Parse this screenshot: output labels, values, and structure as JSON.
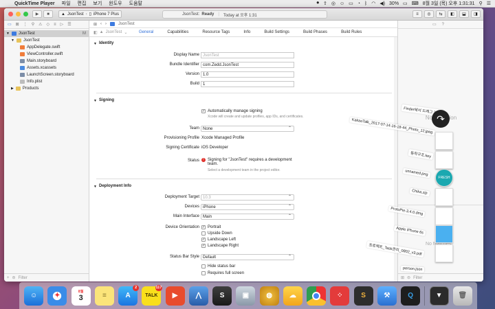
{
  "menubar": {
    "app": "QuickTime Player",
    "items": [
      "파일",
      "편집",
      "보기",
      "윈도우",
      "도움말"
    ],
    "battery": "30%",
    "date": "8월 3일 (목) 오후 1:31:31"
  },
  "toolbar": {
    "scheme": "JsonTest",
    "device": "iPhone 7 Plus",
    "status_prefix": "JsonTest:",
    "status": "Ready",
    "timestamp": "Today at 오후 1:31"
  },
  "navigator": {
    "filter_placeholder": "Filter",
    "items": [
      {
        "label": "JsonTest",
        "badge": "M"
      },
      {
        "label": "JsonTest"
      },
      {
        "label": "AppDelegate.swift"
      },
      {
        "label": "ViewController.swift"
      },
      {
        "label": "Main.storyboard"
      },
      {
        "label": "Assets.xcassets"
      },
      {
        "label": "LaunchScreen.storyboard"
      },
      {
        "label": "Info.plist"
      },
      {
        "label": "Products"
      }
    ]
  },
  "editor": {
    "breadcrumb": "JsonTest",
    "target": "JsonTest",
    "tabs": [
      "General",
      "Capabilities",
      "Resource Tags",
      "Info",
      "Build Settings",
      "Build Phases",
      "Build Rules"
    ],
    "identity": {
      "title": "Identity",
      "display_name_label": "Display Name",
      "display_name_placeholder": "JsonTest",
      "bundle_label": "Bundle Identifier",
      "bundle_value": "com.Zedd.JsonTest",
      "version_label": "Version",
      "version_value": "1.0",
      "build_label": "Build",
      "build_value": "1"
    },
    "signing": {
      "title": "Signing",
      "auto_label": "Automatically manage signing",
      "auto_note": "Xcode will create and update profiles, app IDs, and certificates.",
      "team_label": "Team",
      "team_value": "None",
      "profile_label": "Provisioning Profile",
      "profile_value": "Xcode Managed Profile",
      "cert_label": "Signing Certificate",
      "cert_value": "iOS Developer",
      "status_label": "Status",
      "status_value": "Signing for \"JsonTest\" requires a development team.",
      "status_note": "Select a development team in the project editor."
    },
    "deployment": {
      "title": "Deployment Info",
      "target_label": "Deployment Target",
      "target_value": "10.3",
      "devices_label": "Devices",
      "devices_value": "iPhone",
      "interface_label": "Main Interface",
      "interface_value": "Main",
      "orientation_label": "Device Orientation",
      "orientations": [
        {
          "label": "Portrait",
          "checked": true
        },
        {
          "label": "Upside Down",
          "checked": false
        },
        {
          "label": "Landscape Left",
          "checked": true
        },
        {
          "label": "Landscape Right",
          "checked": true
        }
      ],
      "statusbar_label": "Status Bar Style",
      "statusbar_value": "Default",
      "hide_status_label": "Hide status bar",
      "fullscreen_label": "Requires full screen"
    }
  },
  "inspector": {
    "no_selection": "No Selection",
    "no_selection_2": "No Matches",
    "filter_placeholder": "Filter"
  },
  "desktop_files": [
    "Finder에서 드래그 37개",
    "KakaoTalk_2017-07-14-16-18-44_Photo_12.jpeg",
    "동작구조.key",
    "unnamed.png",
    "Chika.zip",
    "ProtoPie-3.4.0.dmg",
    "Apple iPhone 6s",
    "프로젝트_Task관리_0802_v3.pdf",
    "person.json"
  ],
  "stack": {
    "fresh_label": "FRESH"
  },
  "dock": {
    "calendar_month": "8월",
    "calendar_day": "3",
    "appstore_badge": "2",
    "kakao_label": "TALK",
    "kakao_badge": "117",
    "swift_label": "S"
  }
}
